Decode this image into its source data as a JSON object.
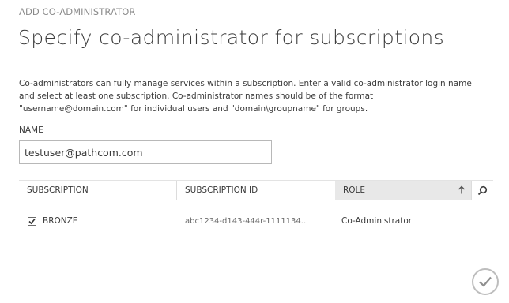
{
  "header": {
    "eyebrow": "ADD CO-ADMINISTRATOR",
    "title": "Specify co-administrator for subscriptions"
  },
  "description": {
    "line1": "Co-administrators can fully manage services within a subscription. Enter a valid co-administrator login name",
    "line2": "and select at least one subscription. Co-administrator names should be of the format",
    "line3": "\"username@domain.com\" for individual users and \"domain\\groupname\" for groups."
  },
  "name_field": {
    "label": "NAME",
    "value": "testuser@pathcom.com"
  },
  "grid": {
    "columns": {
      "subscription": "SUBSCRIPTION",
      "subscription_id": "SUBSCRIPTION ID",
      "role": "ROLE"
    },
    "sort": {
      "column": "role",
      "direction": "ascending",
      "icon": "arrow-up-icon"
    },
    "search_icon": "search-icon",
    "rows": [
      {
        "checked": true,
        "subscription": "BRONZE",
        "subscription_id": "abc1234-d143-444r-1111134..",
        "role": "Co-Administrator"
      }
    ]
  },
  "footer": {
    "confirm_icon": "checkmark-icon"
  },
  "colors": {
    "text": "#3a3a3a",
    "muted": "#8a8a8a",
    "sorted_header_bg": "#e8e8e8",
    "border": "#b8b8b8"
  }
}
